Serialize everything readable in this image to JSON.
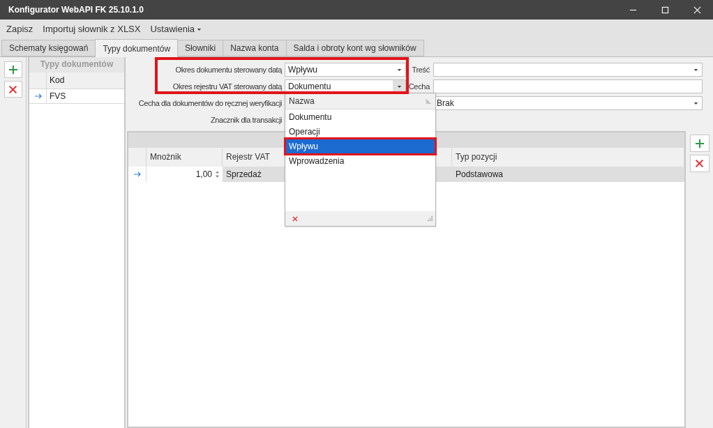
{
  "window": {
    "title": "Konfigurator WebAPI FK 25.10.1.0"
  },
  "menu": [
    {
      "label": "Zapisz",
      "has_submenu": false
    },
    {
      "label": "Importuj słownik z XLSX",
      "has_submenu": false
    },
    {
      "label": "Ustawienia",
      "has_submenu": true
    }
  ],
  "tabs": [
    {
      "label": "Schematy księgowań",
      "selected": false
    },
    {
      "label": "Typy dokumentów",
      "selected": true
    },
    {
      "label": "Słowniki",
      "selected": false
    },
    {
      "label": "Nazwa konta",
      "selected": false
    },
    {
      "label": "Salda i obroty kont wg słowników",
      "selected": false
    }
  ],
  "left_panel": {
    "title": "Typy dokumentów",
    "column": "Kod",
    "rows": [
      {
        "code": "FVS",
        "current": true
      }
    ]
  },
  "form": {
    "rows": [
      {
        "label": "Okres dokumentu sterowany datą",
        "value": "Wpływu",
        "open": false,
        "side": {
          "kind": "combo",
          "label": "Treść"
        }
      },
      {
        "label": "Okres rejestru VAT sterowany datą",
        "value": "Dokumentu",
        "open": true,
        "side": {
          "kind": "text",
          "label": "Cecha"
        }
      },
      {
        "label": "Cecha dla dokumentów do ręcznej weryfikacji",
        "side": {
          "kind": "combo",
          "value": "Brak"
        }
      },
      {
        "label": "Znacznik dla transakcji"
      }
    ]
  },
  "grid": {
    "columns": [
      "Mnożnik",
      "Rejestr VAT",
      "Typ pozycji"
    ],
    "rows": [
      {
        "current": true,
        "cells": [
          "1,00",
          "Sprzedaż",
          "Podstawowa"
        ]
      }
    ]
  },
  "dropdown": {
    "column": "Nazwa",
    "items": [
      {
        "label": "Dokumentu",
        "selected": false
      },
      {
        "label": "Operacji",
        "selected": false
      },
      {
        "label": "Wpływu",
        "selected": true
      },
      {
        "label": "Wprowadzenia",
        "selected": false
      }
    ]
  }
}
